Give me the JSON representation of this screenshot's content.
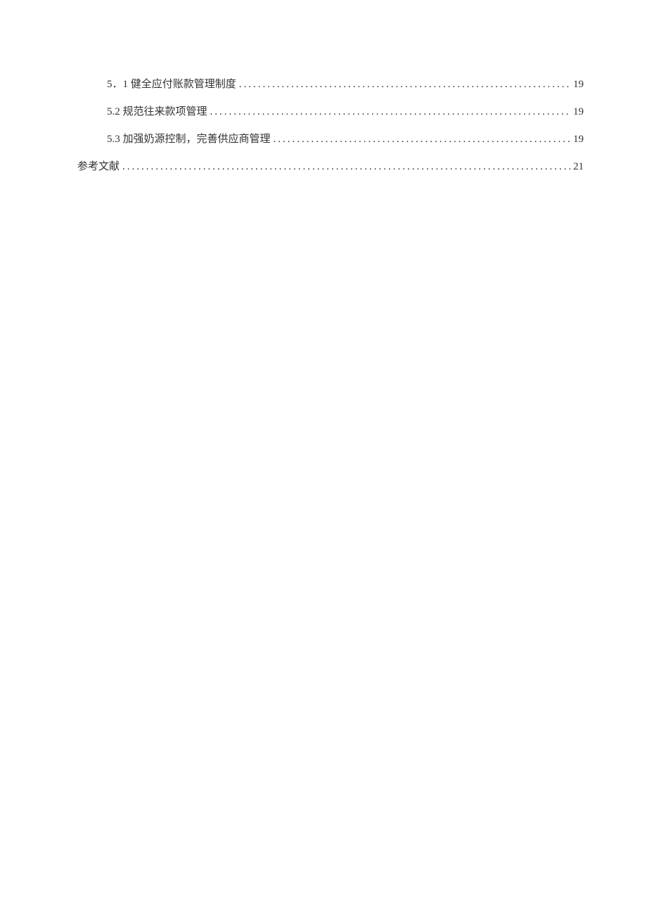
{
  "toc": {
    "entries": [
      {
        "label": "5．1 健全应付账款管理制度 ",
        "page": "19",
        "level": 2
      },
      {
        "label": "5.2 规范往来款项管理",
        "page": "19",
        "level": 2
      },
      {
        "label": "5.3 加强奶源控制，完善供应商管理",
        "page": "19",
        "level": 2
      },
      {
        "label": "参考文献",
        "page": "21",
        "level": 1
      }
    ]
  }
}
